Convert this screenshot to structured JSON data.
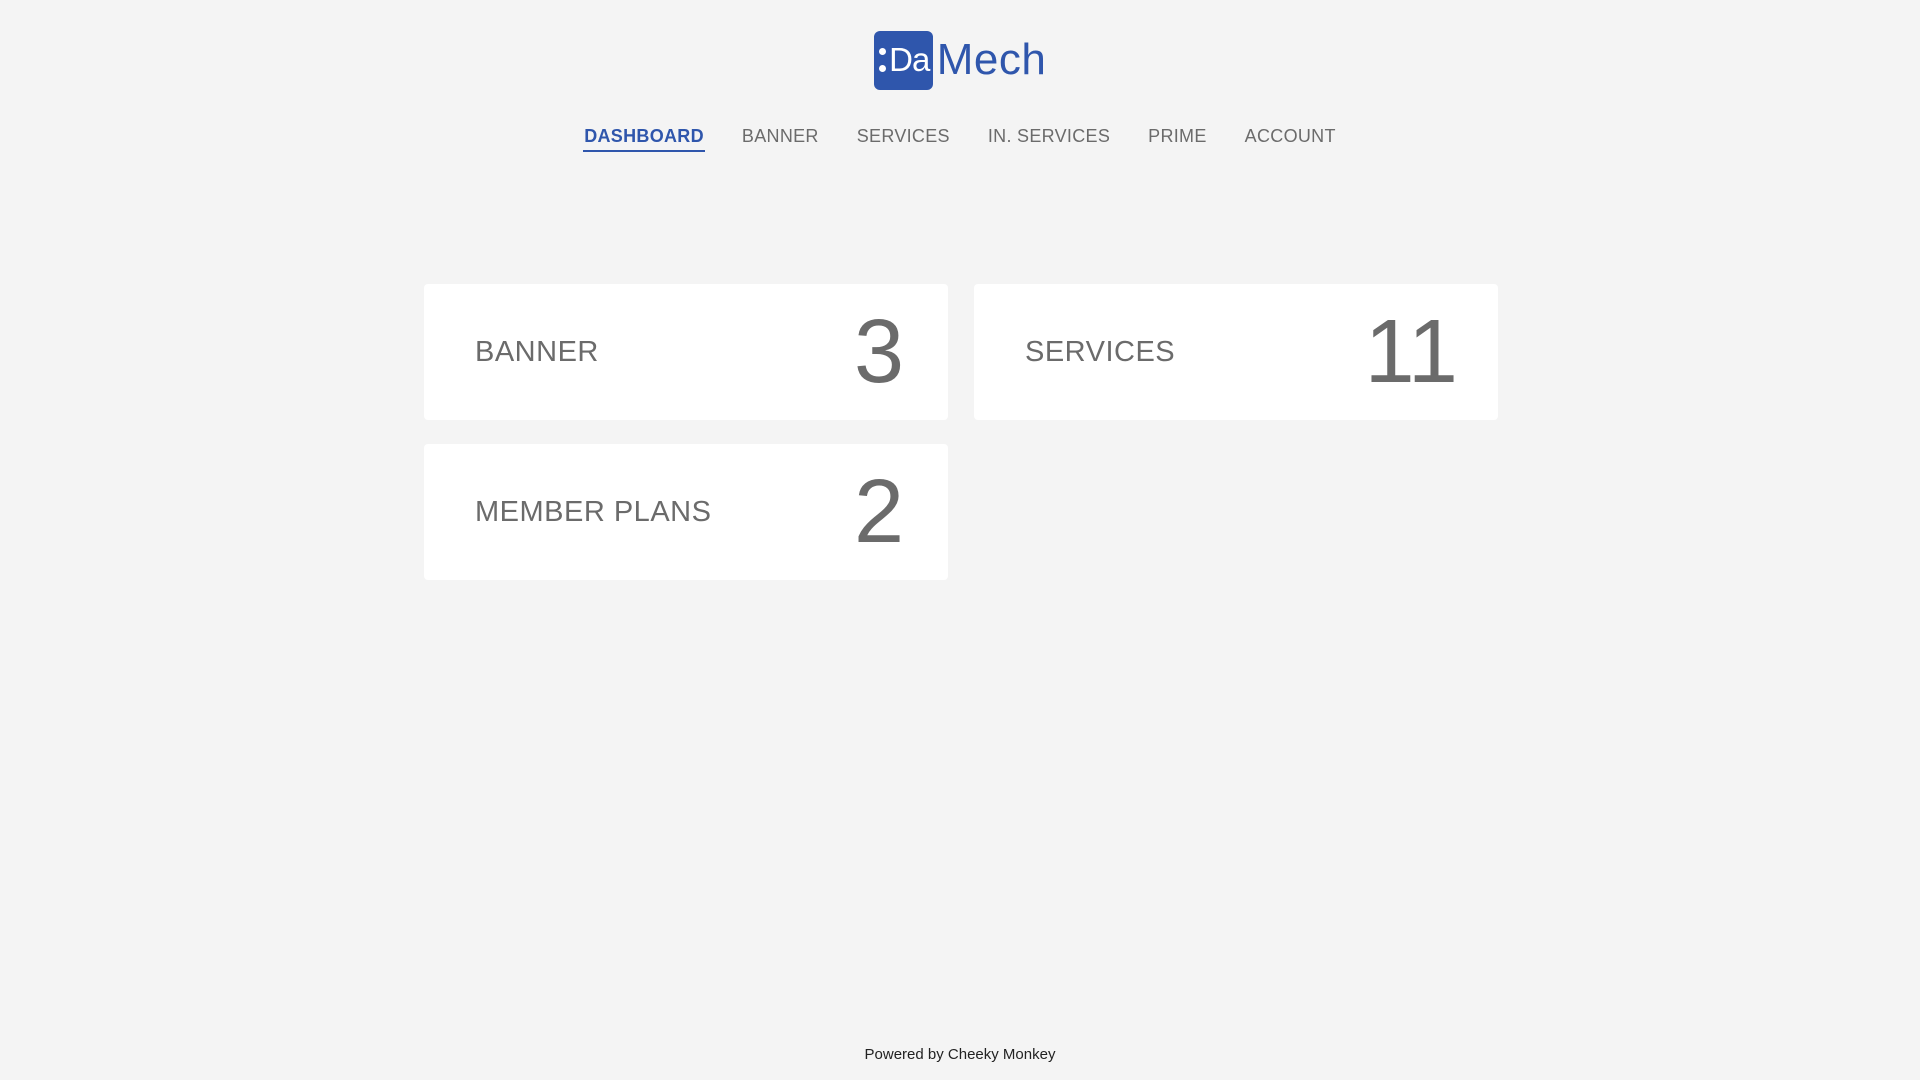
{
  "brand": {
    "badge_text": "Da",
    "word": "Mech",
    "color": "#2f56ac"
  },
  "nav": {
    "items": [
      {
        "label": "DASHBOARD",
        "active": true
      },
      {
        "label": "BANNER",
        "active": false
      },
      {
        "label": "SERVICES",
        "active": false
      },
      {
        "label": "IN. SERVICES",
        "active": false
      },
      {
        "label": "PRIME",
        "active": false
      },
      {
        "label": "ACCOUNT",
        "active": false
      }
    ]
  },
  "cards": {
    "banner": {
      "label": "BANNER",
      "value": "3"
    },
    "services": {
      "label": "SERVICES",
      "value": "11"
    },
    "member_plans": {
      "label": "MEMBER PLANS",
      "value": "2"
    }
  },
  "footer": {
    "text": "Powered by Cheeky Monkey"
  },
  "colors": {
    "background": "#f4f4f4",
    "card": "#ffffff",
    "text": "#6b6b6b",
    "accent": "#2f56ac"
  }
}
